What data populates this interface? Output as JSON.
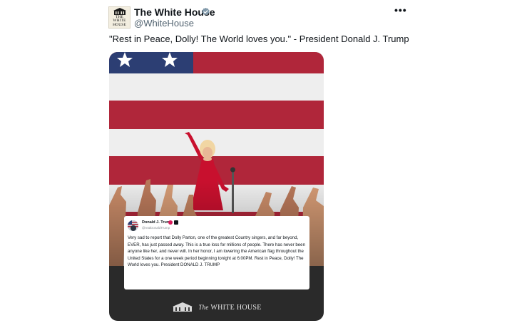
{
  "post": {
    "author_name": "The White House",
    "handle": "@WhiteHouse",
    "verified_icon": "gray-verified-badge",
    "more_label": "•••",
    "text": "\"Rest in Peace, Dolly! The World loves you.\" - President Donald J. Trump"
  },
  "avatar": {
    "line1": "THE WHITE",
    "line2": "HOUSE"
  },
  "quote": {
    "author_name": "Donald J. Trump",
    "handle": "@realDonaldTrump",
    "text": "Very sad to report that Dolly Parton, one of the greatest Country singers, and far beyond, EVER, has just passed away. This is a true loss for millions of people. There has never been anyone like her, and never will. In her honor, I am lowering the American flag throughout the United States for a one week period beginning tonight at 6:00PM. Rest in Peace, Dolly! The World loves you. President DONALD J. TRUMP"
  },
  "brand": {
    "the": "The",
    "name": "WHITE HOUSE"
  },
  "colors": {
    "flag_red": "#b0263a",
    "flag_white": "#eeeeee",
    "flag_blue": "#2c3e73",
    "dress_red": "#c8102e",
    "verified_gray": "#829aab"
  }
}
